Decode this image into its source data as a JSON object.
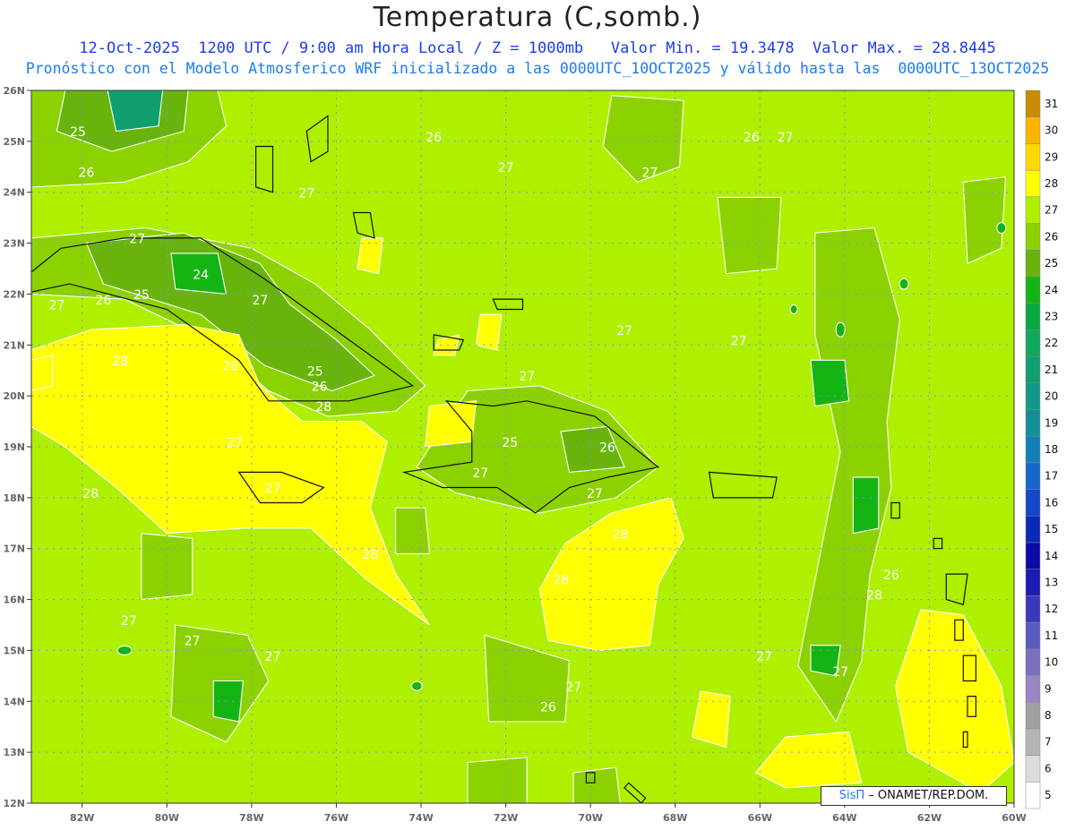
{
  "title": "Temperatura (C,somb.)",
  "subtitle_line1": "12-Oct-2025  1200 UTC / 9:00 am Hora Local / Z = 1000mb   Valor Min. = 19.3478  Valor Max. = 28.8445",
  "subtitle_line2": "Pronóstico con el Modelo Atmosferico WRF inicializado a las 0000UTC_10OCT2025 y válido hasta las  0000UTC_13OCT2025",
  "credit": {
    "brand": "SisΠ",
    "text": " – ONAMET/REP.DOM."
  },
  "map": {
    "lon_range": [
      -83.2,
      -60
    ],
    "lat_range": [
      12,
      26
    ],
    "lon_ticks": [
      "82W",
      "80W",
      "78W",
      "76W",
      "74W",
      "72W",
      "70W",
      "68W",
      "66W",
      "64W",
      "62W",
      "60W"
    ],
    "lat_ticks": [
      "12N",
      "13N",
      "14N",
      "15N",
      "16N",
      "17N",
      "18N",
      "19N",
      "20N",
      "21N",
      "22N",
      "23N",
      "24N",
      "25N",
      "26N"
    ],
    "background_color": "#aef000",
    "grid": true,
    "contour_labels": [
      "25",
      "26",
      "27",
      "24",
      "25",
      "26",
      "27",
      "27",
      "27",
      "28",
      "28",
      "25",
      "26",
      "28",
      "27",
      "28",
      "27",
      "28",
      "26",
      "25",
      "27",
      "27",
      "26",
      "27",
      "28",
      "28",
      "27",
      "27",
      "26",
      "27",
      "27",
      "27",
      "28",
      "26",
      "27",
      "27",
      "27",
      "26",
      "27",
      "27",
      "27"
    ]
  },
  "colorbar": {
    "levels": [
      "5",
      "6",
      "7",
      "8",
      "9",
      "10",
      "11",
      "12",
      "13",
      "14",
      "15",
      "16",
      "17",
      "18",
      "19",
      "20",
      "21",
      "22",
      "23",
      "24",
      "25",
      "26",
      "27",
      "28",
      "29",
      "30",
      "31"
    ],
    "colors": [
      "#ffffff",
      "#dcdcdc",
      "#b4b4b4",
      "#a0a0a0",
      "#9a86c4",
      "#7a70c0",
      "#5a5ac0",
      "#3a3ab8",
      "#1c1cb4",
      "#0a0aa8",
      "#0a2ab8",
      "#1448c8",
      "#1466c8",
      "#1280b8",
      "#129098",
      "#129888",
      "#10a070",
      "#10a85a",
      "#0ca840",
      "#14b414",
      "#68b40c",
      "#8cd200",
      "#aef000",
      "#ffff00",
      "#ffd800",
      "#ffb400",
      "#c88c00"
    ]
  }
}
